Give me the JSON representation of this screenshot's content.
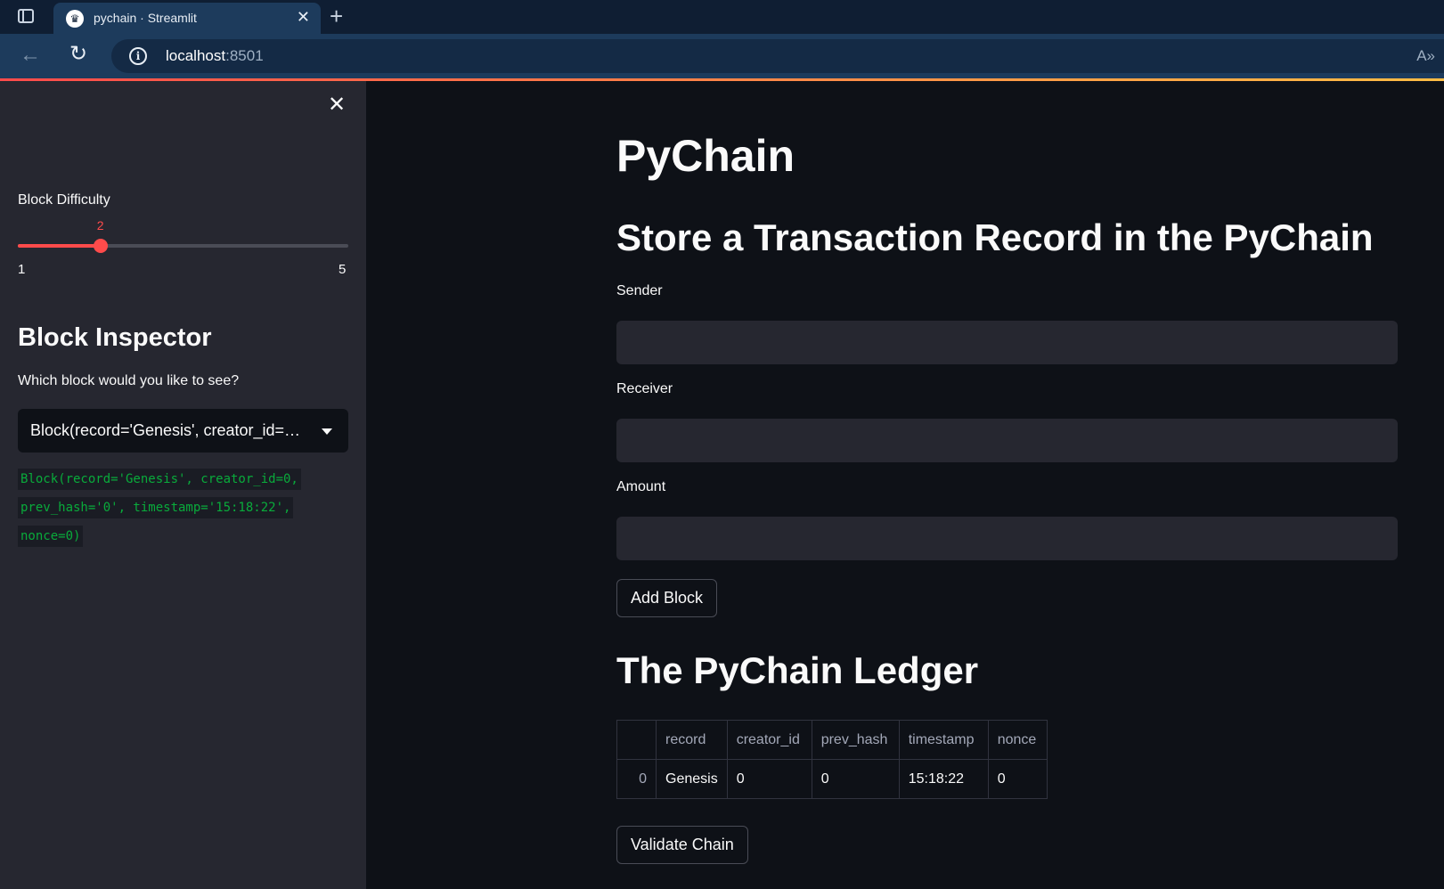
{
  "browser": {
    "tab_title": "pychain · Streamlit",
    "url_host": "localhost",
    "url_port": ":8501"
  },
  "sidebar": {
    "slider": {
      "label": "Block Difficulty",
      "value": 2,
      "min": 1,
      "max": 5,
      "accent_color": "#ff4b4b"
    },
    "heading": "Block Inspector",
    "select_label": "Which block would you like to see?",
    "select_value": "Block(record='Genesis', creator_id=0, prev_hash='0', timestamp='15:18:22', nonce=0)",
    "code_lines": [
      "Block(record='Genesis', creator_id=0,",
      "prev_hash='0', timestamp='15:18:22',",
      "nonce=0)"
    ]
  },
  "main": {
    "title": "PyChain",
    "section_heading": "Store a Transaction Record in the PyChain",
    "fields": {
      "sender_label": "Sender",
      "receiver_label": "Receiver",
      "amount_label": "Amount"
    },
    "add_block_label": "Add Block",
    "ledger_heading": "The PyChain Ledger",
    "table": {
      "columns": [
        "",
        "record",
        "creator_id",
        "prev_hash",
        "timestamp",
        "nonce"
      ],
      "rows": [
        [
          "0",
          "Genesis",
          "0",
          "0",
          "15:18:22",
          "0"
        ]
      ]
    },
    "validate_label": "Validate Chain"
  }
}
